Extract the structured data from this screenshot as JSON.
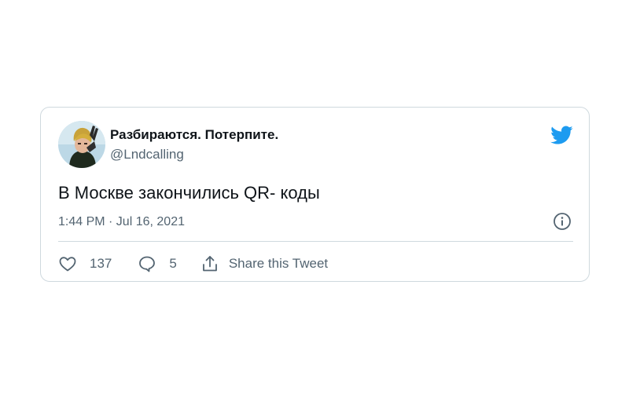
{
  "author": {
    "name": "Разбираются. Потерпите.",
    "handle": "@Lndcalling"
  },
  "tweet": {
    "text": "В Москве закончились QR- коды",
    "timestamp": "1:44 PM · Jul 16, 2021"
  },
  "actions": {
    "likes": "137",
    "replies": "5",
    "share_label": "Share this Tweet"
  },
  "icons": {
    "brand": "twitter-bird-icon",
    "info": "info-icon",
    "like": "heart-icon",
    "reply": "speech-bubble-icon",
    "share": "share-icon"
  },
  "colors": {
    "brand": "#1d9bf0",
    "text_primary": "#0f1419",
    "text_secondary": "#536471",
    "border": "#cfd9de"
  }
}
